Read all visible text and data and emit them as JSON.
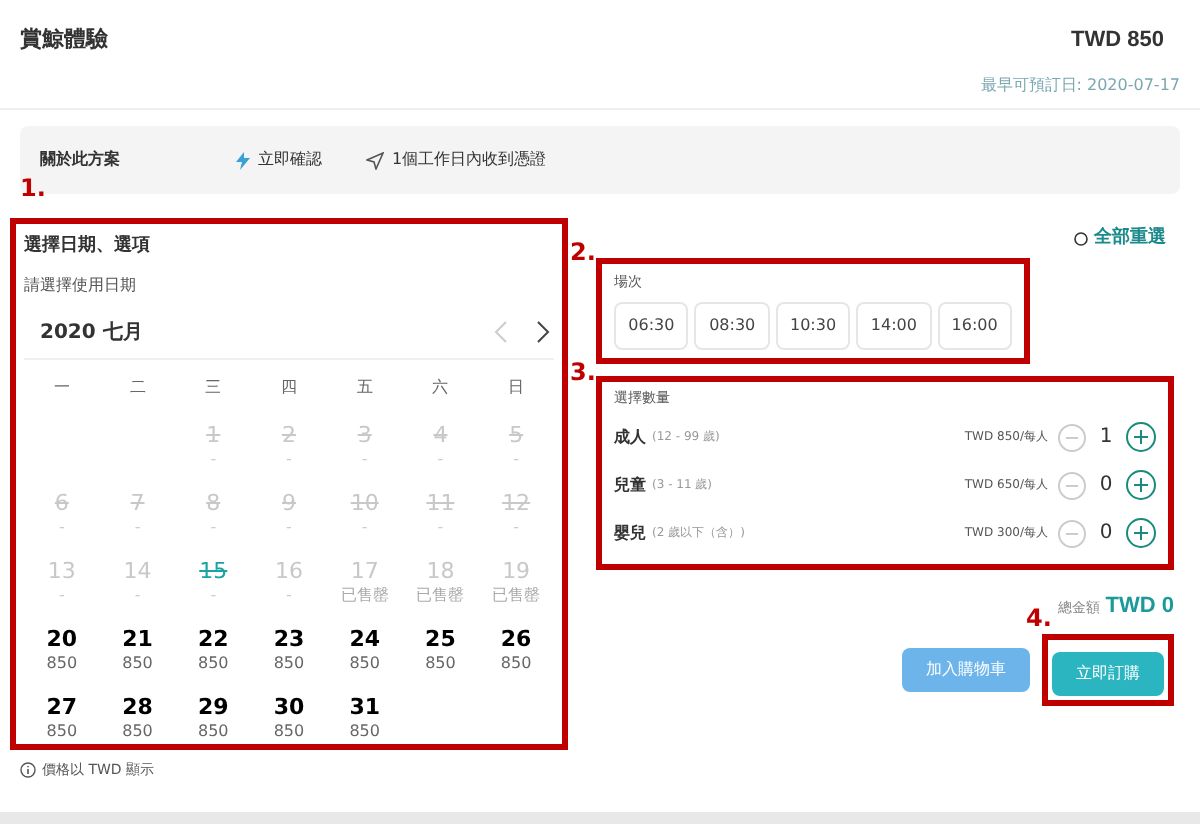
{
  "header": {
    "title": "賞鯨體驗",
    "price": "TWD 850",
    "earliest": "最早可預訂日: 2020-07-17"
  },
  "info_bar": {
    "label": "關於此方案",
    "items": [
      {
        "kind": "instant",
        "text": "立即確認"
      },
      {
        "kind": "send",
        "text": "1個工作日內收到憑證"
      }
    ]
  },
  "calendar": {
    "title": "選擇日期、選項",
    "subtitle": "請選擇使用日期",
    "month": "2020 七月",
    "weekdays": [
      "一",
      "二",
      "三",
      "四",
      "五",
      "六",
      "日"
    ],
    "weeks": [
      [
        {
          "day": "1",
          "sub": "-",
          "kind": "past"
        },
        {
          "day": "2",
          "sub": "-",
          "kind": "past"
        },
        {
          "day": "3",
          "sub": "-",
          "kind": "past"
        },
        {
          "day": "4",
          "sub": "-",
          "kind": "past"
        },
        {
          "day": "5",
          "sub": "-",
          "kind": "past"
        }
      ],
      [
        {
          "day": "6",
          "sub": "-",
          "kind": "past"
        },
        {
          "day": "7",
          "sub": "-",
          "kind": "past"
        },
        {
          "day": "8",
          "sub": "-",
          "kind": "past"
        },
        {
          "day": "9",
          "sub": "-",
          "kind": "past"
        },
        {
          "day": "10",
          "sub": "-",
          "kind": "past"
        },
        {
          "day": "11",
          "sub": "-",
          "kind": "past"
        },
        {
          "day": "12",
          "sub": "-",
          "kind": "past"
        }
      ],
      [
        {
          "day": "13",
          "sub": "-",
          "kind": "unavailable"
        },
        {
          "day": "14",
          "sub": "-",
          "kind": "unavailable"
        },
        {
          "day": "15",
          "sub": "-",
          "kind": "today"
        },
        {
          "day": "16",
          "sub": "-",
          "kind": "unavailable"
        },
        {
          "day": "17",
          "sub": "已售罄",
          "kind": "soldout"
        },
        {
          "day": "18",
          "sub": "已售罄",
          "kind": "soldout"
        },
        {
          "day": "19",
          "sub": "已售罄",
          "kind": "soldout"
        }
      ],
      [
        {
          "day": "20",
          "sub": "850",
          "kind": "available"
        },
        {
          "day": "21",
          "sub": "850",
          "kind": "available"
        },
        {
          "day": "22",
          "sub": "850",
          "kind": "available"
        },
        {
          "day": "23",
          "sub": "850",
          "kind": "available"
        },
        {
          "day": "24",
          "sub": "850",
          "kind": "available"
        },
        {
          "day": "25",
          "sub": "850",
          "kind": "available"
        },
        {
          "day": "26",
          "sub": "850",
          "kind": "available"
        }
      ],
      [
        {
          "day": "27",
          "sub": "850",
          "kind": "available"
        },
        {
          "day": "28",
          "sub": "850",
          "kind": "available"
        },
        {
          "day": "29",
          "sub": "850",
          "kind": "available"
        },
        {
          "day": "30",
          "sub": "850",
          "kind": "available"
        },
        {
          "day": "31",
          "sub": "850",
          "kind": "available"
        }
      ]
    ],
    "note": "價格以 TWD 顯示"
  },
  "reset": "全部重選",
  "sessions": {
    "label": "場次",
    "times": [
      {
        "text": "06:30",
        "selected": false
      },
      {
        "text": "08:30",
        "selected": false
      },
      {
        "text": "10:30",
        "selected": false
      },
      {
        "text": "14:00",
        "selected": false
      },
      {
        "text": "16:00",
        "selected": false
      }
    ]
  },
  "quantity": {
    "label": "選擇數量",
    "rows": [
      {
        "name": "成人",
        "range": "(12 - 99 歲)",
        "price": "TWD 850/每人",
        "count": "1"
      },
      {
        "name": "兒童",
        "range": "(3 - 11 歲)",
        "price": "TWD 650/每人",
        "count": "0"
      },
      {
        "name": "嬰兒",
        "range": "(2 歲以下（含）)",
        "price": "TWD 300/每人",
        "count": "0"
      }
    ]
  },
  "total": {
    "label": "總金額",
    "value": "TWD 0"
  },
  "buttons": [
    {
      "kind": "cart",
      "text": "加入購物車"
    },
    {
      "kind": "buy",
      "text": "立即訂購"
    }
  ],
  "annotations": [
    "1.",
    "2.",
    "3.",
    "4."
  ]
}
